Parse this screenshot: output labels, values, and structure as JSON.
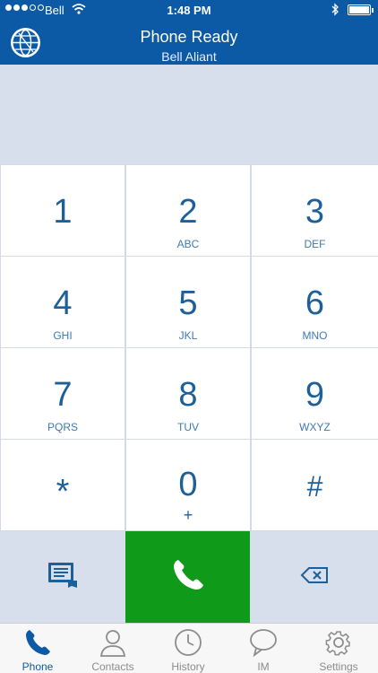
{
  "status_bar": {
    "carrier": "Bell",
    "time": "1:48 PM",
    "signal_bars_filled": 3,
    "signal_bars_total": 5
  },
  "header": {
    "title": "Phone Ready",
    "subtitle": "Bell Aliant",
    "logo_icon": "globe-icon"
  },
  "keys": [
    {
      "digit": "1",
      "letters": ""
    },
    {
      "digit": "2",
      "letters": "ABC"
    },
    {
      "digit": "3",
      "letters": "DEF"
    },
    {
      "digit": "4",
      "letters": "GHI"
    },
    {
      "digit": "5",
      "letters": "JKL"
    },
    {
      "digit": "6",
      "letters": "MNO"
    },
    {
      "digit": "7",
      "letters": "PQRS"
    },
    {
      "digit": "8",
      "letters": "TUV"
    },
    {
      "digit": "9",
      "letters": "WXYZ"
    },
    {
      "digit": "*",
      "letters": ""
    },
    {
      "digit": "0",
      "letters": "+"
    },
    {
      "digit": "#",
      "letters": ""
    }
  ],
  "actions": {
    "left_icon": "message-icon",
    "call_icon": "phone-icon",
    "right_icon": "backspace-icon"
  },
  "tabs": [
    {
      "label": "Phone",
      "icon": "phone-icon",
      "active": true
    },
    {
      "label": "Contacts",
      "icon": "person-icon",
      "active": false
    },
    {
      "label": "History",
      "icon": "clock-icon",
      "active": false
    },
    {
      "label": "IM",
      "icon": "chat-bubble-icon",
      "active": false
    },
    {
      "label": "Settings",
      "icon": "gear-icon",
      "active": false
    }
  ],
  "colors": {
    "header_bg": "#0c5aa6",
    "call_green": "#109a1a",
    "keypad_text": "#1c5f99",
    "tab_active": "#0c5aa6"
  }
}
